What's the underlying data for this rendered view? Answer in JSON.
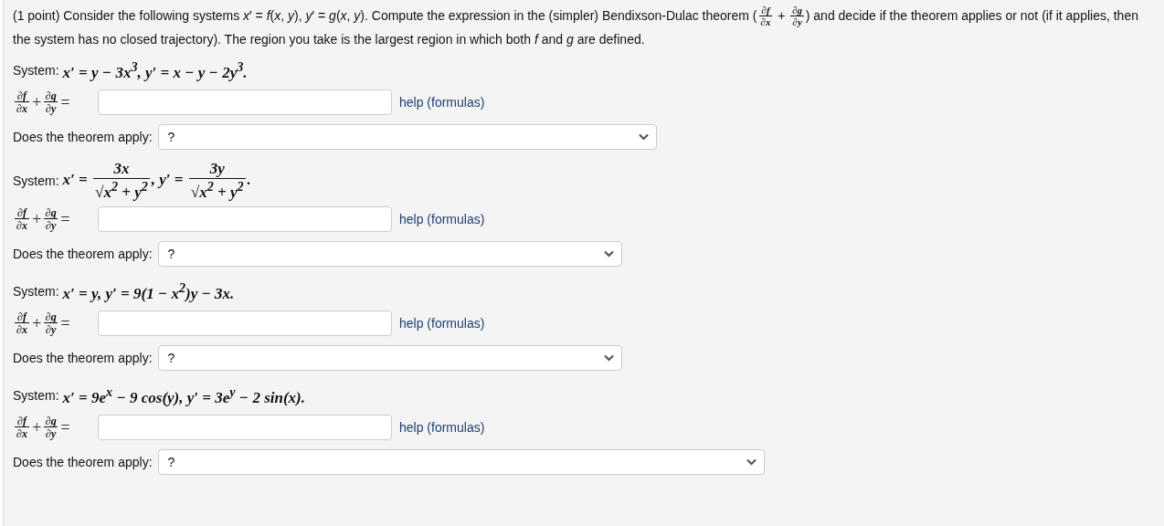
{
  "intro": [
    {
      "kind": "text",
      "text": "(1 point) Consider the following systems *x*′ = *f*(*x*, *y*), *y*′ = *g*(*x*, *y*). Compute the expression in the (simpler) Bendixson-Dulac theorem ("
    },
    {
      "kind": "fraction",
      "num": "∂*f*",
      "den": "∂*x*"
    },
    {
      "kind": "text",
      "text": " + "
    },
    {
      "kind": "fraction",
      "num": "∂*g*",
      "den": "∂*y*"
    },
    {
      "kind": "text",
      "text": ") and decide if the theorem applies or not (if it applies, then the system has no closed trajectory). The region you take is the largest region in which both *f* and *g* are defined."
    }
  ],
  "problems": [
    {
      "label": "System:",
      "formula": [
        {
          "kind": "text",
          "text": "x′ = y − 3x$^{3}$, y′ = x − y − 2y$^{3}$."
        }
      ],
      "answer_label": [
        {
          "kind": "fraction",
          "num": "∂f",
          "den": "∂x"
        },
        {
          "kind": "text",
          "text": " + "
        },
        {
          "kind": "fraction",
          "num": "∂g",
          "den": "∂y"
        },
        {
          "kind": "text",
          "text": " ="
        }
      ],
      "help": "help (formulas)",
      "question": "Does the theorem apply:",
      "choice": "?"
    },
    {
      "label": "System:",
      "formula": [
        {
          "kind": "text",
          "text": "x′ = "
        },
        {
          "kind": "fraction",
          "num": "3x",
          "den": "√x$^{2}$ + y$^{2}$"
        },
        {
          "kind": "text",
          "text": ", y′ = "
        },
        {
          "kind": "fraction",
          "num": "3y",
          "den": "√x$^{2}$ + y$^{2}$"
        },
        {
          "kind": "text",
          "text": "."
        }
      ],
      "answer_label": [
        {
          "kind": "fraction",
          "num": "∂f",
          "den": "∂x"
        },
        {
          "kind": "text",
          "text": " + "
        },
        {
          "kind": "fraction",
          "num": "∂g",
          "den": "∂y"
        },
        {
          "kind": "text",
          "text": " ="
        }
      ],
      "help": "help (formulas)",
      "question": "Does the theorem apply:",
      "choice": "?"
    },
    {
      "label": "System:",
      "formula": [
        {
          "kind": "text",
          "text": "x′ = y, y′ = 9(1 − x$^{2}$)y − 3x."
        }
      ],
      "answer_label": [
        {
          "kind": "fraction",
          "num": "∂f",
          "den": "∂x"
        },
        {
          "kind": "text",
          "text": " + "
        },
        {
          "kind": "fraction",
          "num": "∂g",
          "den": "∂y"
        },
        {
          "kind": "text",
          "text": " ="
        }
      ],
      "help": "help (formulas)",
      "question": "Does the theorem apply:",
      "choice": "?"
    },
    {
      "label": "System:",
      "formula": [
        {
          "kind": "text",
          "text": "x′ = 9e$^{x}$ − 9 cos(y), y′ = 3e$^{y}$ − 2 sin(x)."
        }
      ],
      "answer_label": [
        {
          "kind": "fraction",
          "num": "∂f",
          "den": "∂x"
        },
        {
          "kind": "text",
          "text": " + "
        },
        {
          "kind": "fraction",
          "num": "∂g",
          "den": "∂y"
        },
        {
          "kind": "text",
          "text": " ="
        }
      ],
      "help": "help (formulas)",
      "question": "Does the theorem apply:",
      "choice": "?"
    }
  ]
}
